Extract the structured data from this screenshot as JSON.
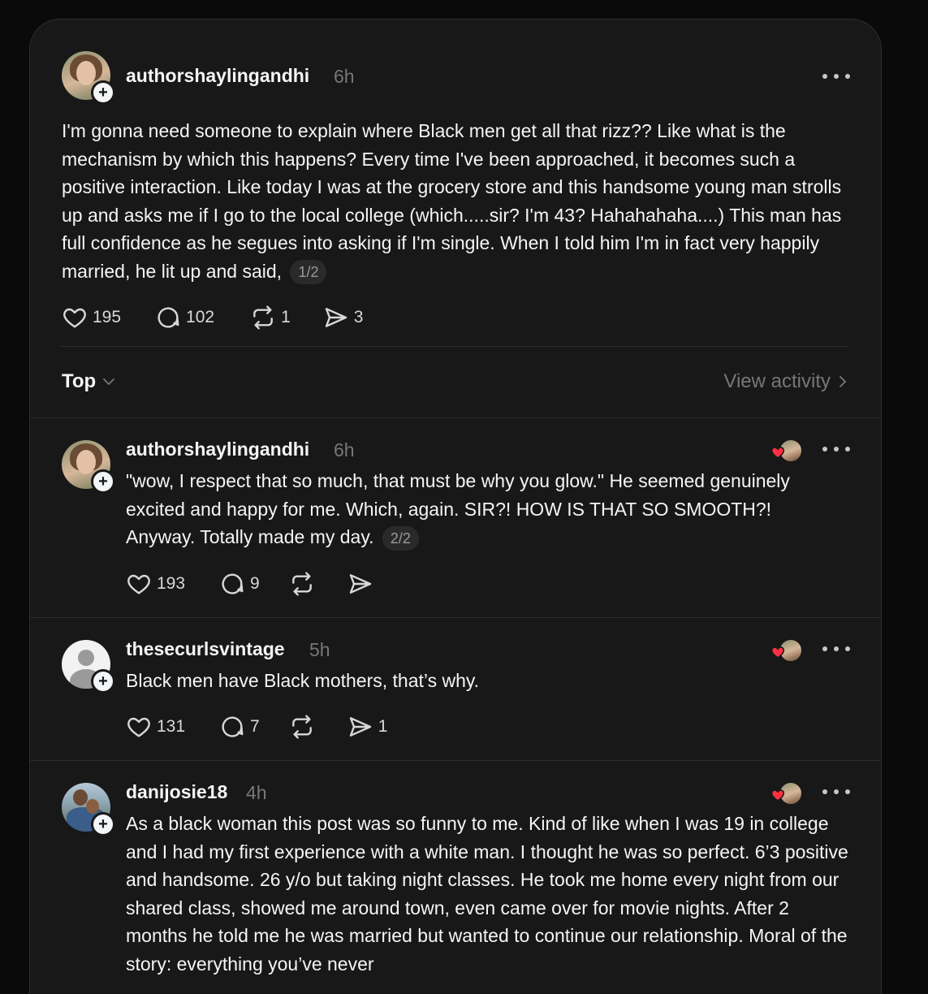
{
  "post": {
    "username": "authorshaylingandhi",
    "time": "6h",
    "text": "I'm gonna need someone to explain where Black men get all that rizz?? Like what is the mechanism by which this happens? Every time I've been approached, it becomes such a positive interaction. Like today I was at the grocery store and this handsome young man strolls up and asks me if I go to the local college (which.....sir? I'm 43? Hahahahaha....) This man has full confidence as he segues into asking if I'm single. When I told him I'm in fact very happily married, he lit up and said,",
    "pager": "1/2",
    "likes": "195",
    "replies": "102",
    "reposts": "1",
    "shares": "3"
  },
  "sort": {
    "label": "Top",
    "view_activity": "View activity"
  },
  "replies": [
    {
      "username": "authorshaylingandhi",
      "time": "6h",
      "text": "\"wow, I respect that so much, that must be why you glow.\" He seemed genuinely excited and happy for me. Which, again. SIR?! HOW IS THAT SO SMOOTH?! Anyway. Totally made my day.",
      "pager": "2/2",
      "likes": "193",
      "replies": "9",
      "reposts": "",
      "shares": ""
    },
    {
      "username": "thesecurlsvintage",
      "time": "5h",
      "text": "Black men have Black mothers, that’s why.",
      "likes": "131",
      "replies": "7",
      "reposts": "",
      "shares": "1"
    },
    {
      "username": "danijosie18",
      "time": "4h",
      "text": "As a black woman this post was so funny to me. Kind of like when I was 19 in college and I had my first experience with a white man. I thought he was so perfect. 6’3 positive and handsome. 26 y/o but taking night classes. He took me home every night from our shared class, showed me around town, even came over for movie nights. After 2 months he told me he was married but wanted to continue our relationship. Moral of the story: everything you’ve never"
    }
  ],
  "colors": {
    "background": "#0a0a0a",
    "panel": "#181818",
    "text": "#f3f5f7",
    "muted": "#777777",
    "heart": "#ff3040"
  }
}
